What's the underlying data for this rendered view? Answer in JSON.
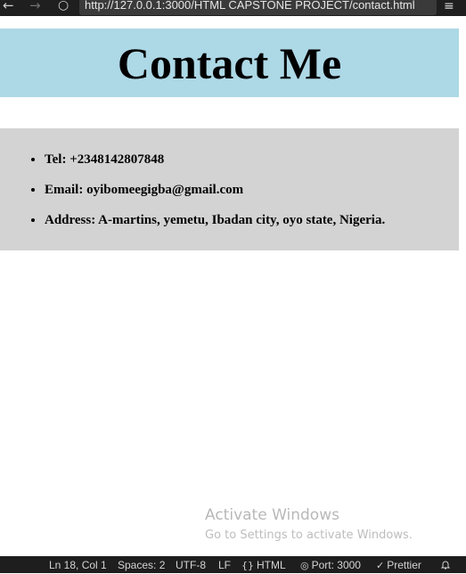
{
  "browser": {
    "url": "http://127.0.0.1:3000/HTML CAPSTONE PROJECT/contact.html",
    "icons": {
      "back": "back-arrow-icon",
      "forward": "forward-arrow-icon",
      "reload": "reload-icon",
      "menu": "hamburger-menu-icon"
    }
  },
  "page": {
    "title": "Contact Me",
    "header_color": "#add8e6",
    "contact_box_color": "#d3d3d3",
    "contacts": [
      "Tel: +2348142807848",
      "Email: oyibomeegigba@gmail.com",
      "Address: A-martins, yemetu, Ibadan city, oyo state, Nigeria."
    ]
  },
  "watermark": {
    "title": "Activate Windows",
    "subtitle": "Go to Settings to activate Windows."
  },
  "status_bar": {
    "position": "Ln 18, Col 1",
    "spaces": "Spaces: 2",
    "encoding": "UTF-8",
    "eol": "LF",
    "language": "HTML",
    "port": "Port: 3000",
    "formatter": "Prettier"
  }
}
